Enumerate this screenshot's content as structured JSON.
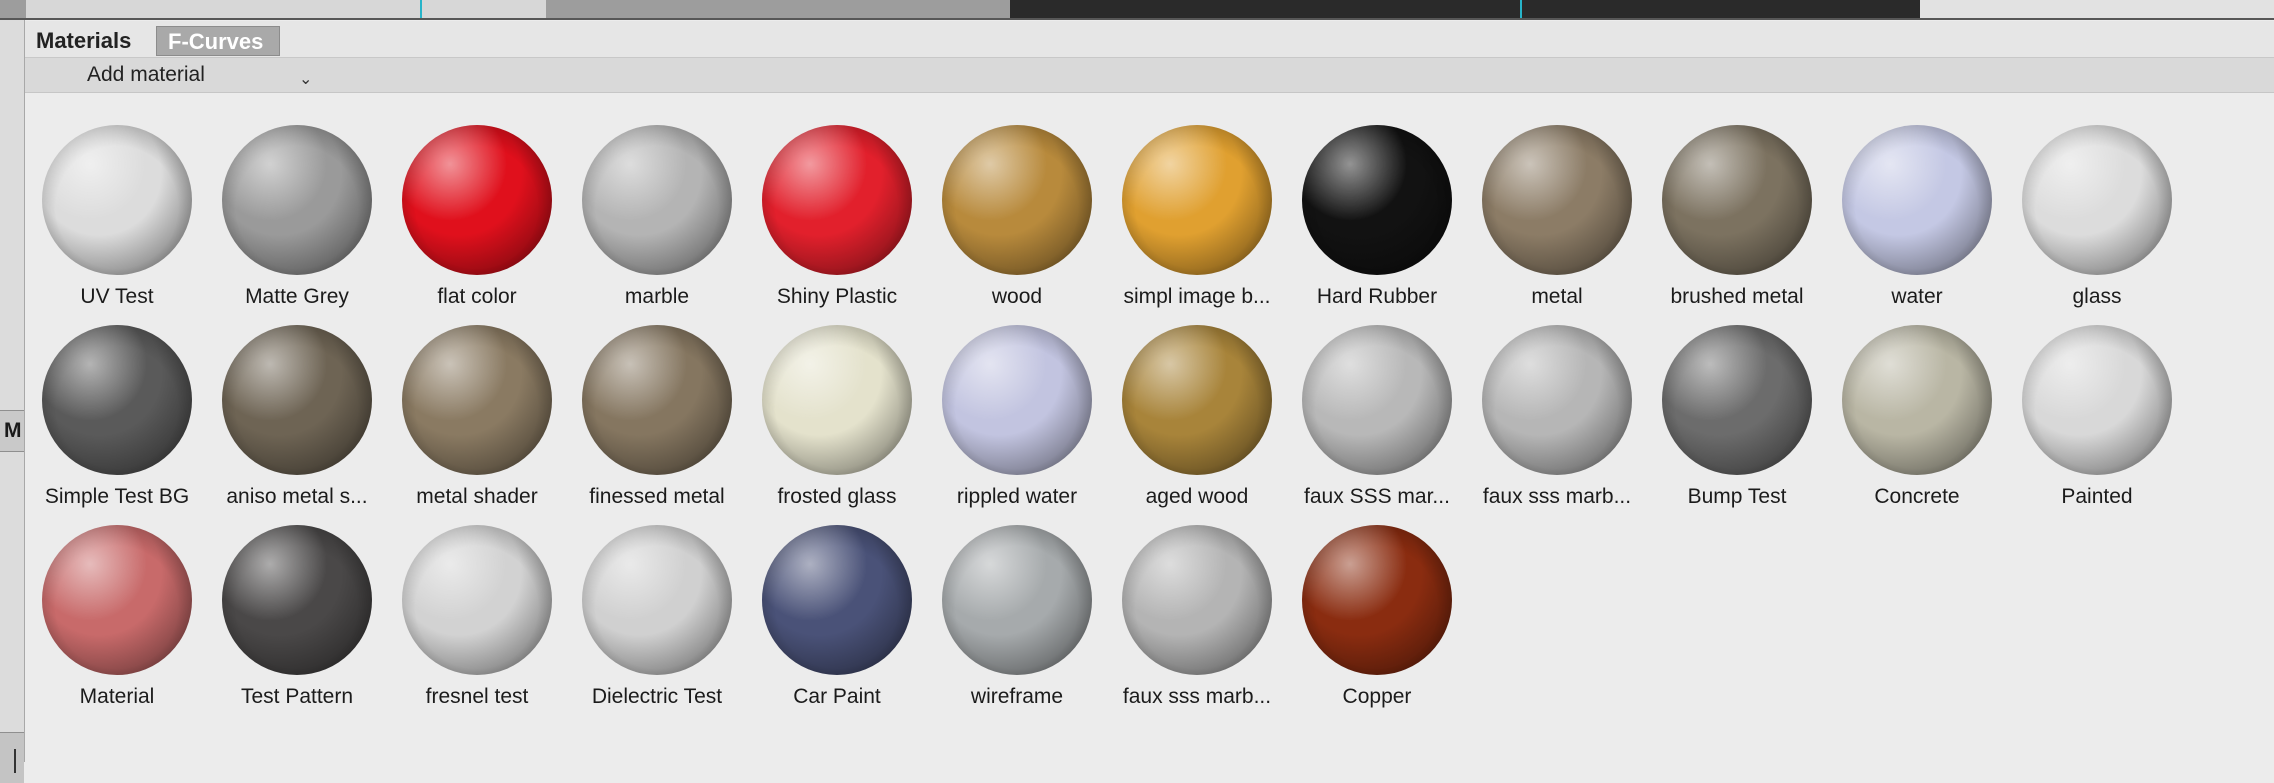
{
  "tabs": [
    {
      "label": "Materials",
      "active": true
    },
    {
      "label": "F-Curves",
      "active": false
    }
  ],
  "left_tab_label": "M",
  "toolbar": {
    "add_material": "Add material",
    "chevron_icon": "chevron-down-icon"
  },
  "materials": [
    {
      "name": "UV Test",
      "color": "#dcdcdc"
    },
    {
      "name": "Matte Grey",
      "color": "#9a9a9a"
    },
    {
      "name": "flat color",
      "color": "#e0101c"
    },
    {
      "name": "marble",
      "color": "#b4b4b4"
    },
    {
      "name": "Shiny Plastic",
      "color": "#e2202c"
    },
    {
      "name": "wood",
      "color": "#b88a3c"
    },
    {
      "name": "simpl image b...",
      "color": "#e0a030"
    },
    {
      "name": "Hard Rubber",
      "color": "#121212"
    },
    {
      "name": "metal",
      "color": "#8c7c66"
    },
    {
      "name": "brushed metal",
      "color": "#7c7260"
    },
    {
      "name": "water",
      "color": "#c4c8e4"
    },
    {
      "name": "glass",
      "color": "#dcdcdc"
    },
    {
      "name": "Simple Test BG",
      "color": "#5a5a5a"
    },
    {
      "name": "aniso metal s...",
      "color": "#6e6454"
    },
    {
      "name": "metal shader",
      "color": "#8a7a62"
    },
    {
      "name": "finessed metal",
      "color": "#857660"
    },
    {
      "name": "frosted glass",
      "color": "#e4e2cc"
    },
    {
      "name": "rippled water",
      "color": "#c2c4e0"
    },
    {
      "name": "aged wood",
      "color": "#a8843a"
    },
    {
      "name": "faux SSS mar...",
      "color": "#b8b8b8"
    },
    {
      "name": "faux sss marb...",
      "color": "#b6b6b6"
    },
    {
      "name": "Bump Test",
      "color": "#6c6c6c"
    },
    {
      "name": "Concrete",
      "color": "#b9b6a4"
    },
    {
      "name": "Painted",
      "color": "#d8d8d8"
    },
    {
      "name": "Material",
      "color": "#c86a6a"
    },
    {
      "name": "Test Pattern",
      "color": "#4a4848"
    },
    {
      "name": "fresnel test",
      "color": "#d2d2d2"
    },
    {
      "name": "Dielectric Test",
      "color": "#d0d0d0"
    },
    {
      "name": "Car Paint",
      "color": "#4a5278"
    },
    {
      "name": "wireframe",
      "color": "#a6aaac"
    },
    {
      "name": "faux sss marb...",
      "color": "#b4b4b4"
    },
    {
      "name": "Copper",
      "color": "#8a2c10"
    }
  ]
}
